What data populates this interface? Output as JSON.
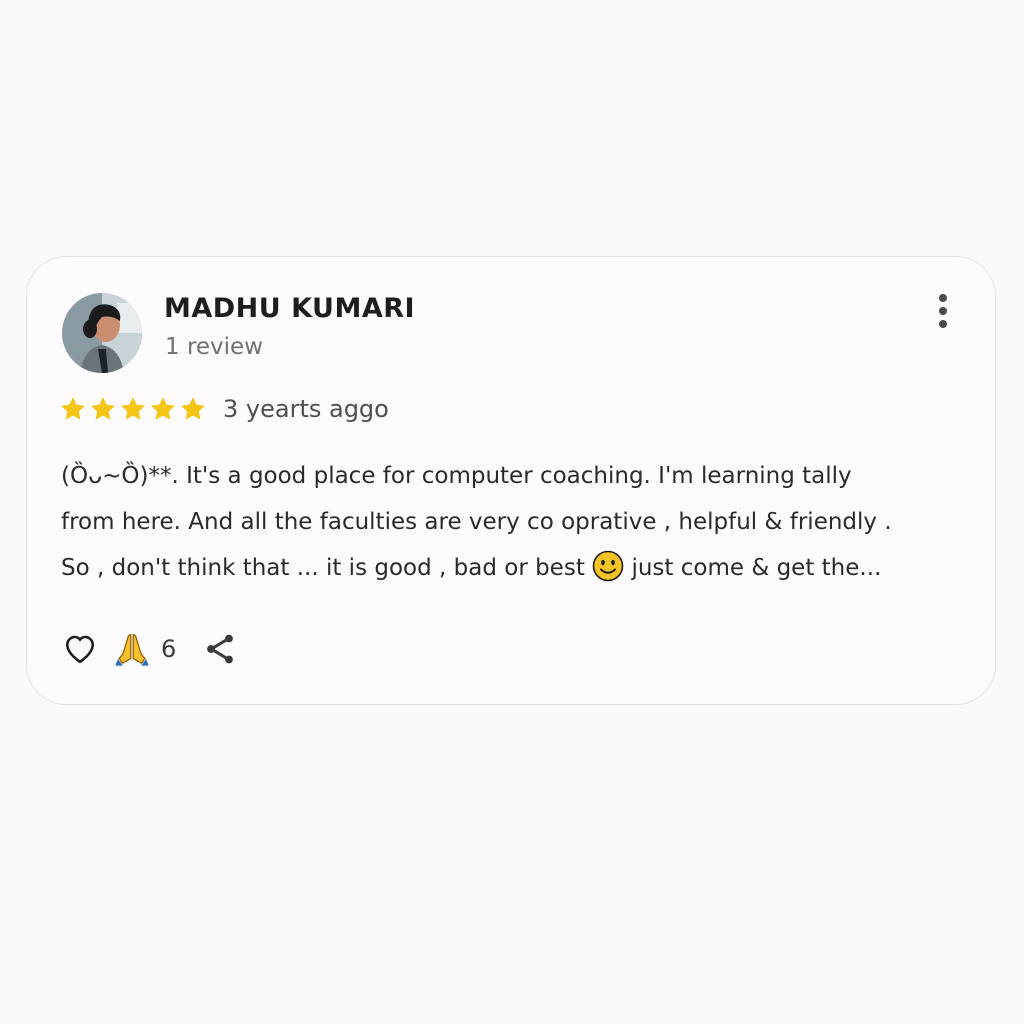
{
  "review": {
    "author_name": "MADHU KUMARI",
    "review_count": "1 review",
    "rating": 5,
    "rating_max": 5,
    "time_ago": "3 yearts aggo",
    "text_lines": [
      "(Ȍᴗ~Ȍ)**.  It's a good place for computer coaching. I'm learning tally",
      "from here.  And all the faculties are very co oprative , helpful & friendly .",
      "So , don't think that ... it is good , bad or best",
      " just come & get the..."
    ],
    "reaction_count": "6"
  },
  "icons": {
    "avatar": "user-avatar-photo",
    "more": "more-vertical-icon",
    "star": "star-icon",
    "smiley": "smiley-emoji-icon",
    "like": "heart-icon",
    "reaction": "folded-hands-emoji-icon",
    "share": "share-icon"
  },
  "colors": {
    "star": "#f5c518",
    "text": "#2a2a2e",
    "muted": "#6f6f73"
  }
}
